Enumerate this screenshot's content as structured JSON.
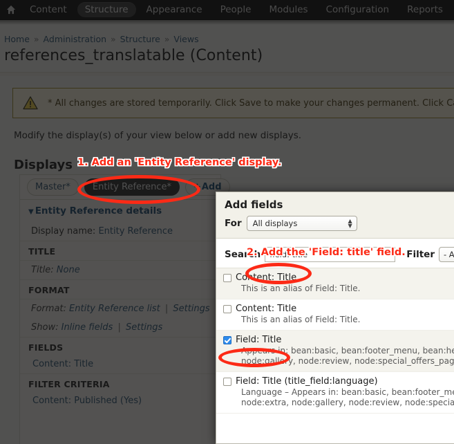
{
  "toolbar": {
    "home_icon": "home-icon",
    "items": [
      {
        "label": "Content",
        "active": false
      },
      {
        "label": "Structure",
        "active": true
      },
      {
        "label": "Appearance",
        "active": false
      },
      {
        "label": "People",
        "active": false
      },
      {
        "label": "Modules",
        "active": false
      },
      {
        "label": "Configuration",
        "active": false
      },
      {
        "label": "Reports",
        "active": false
      }
    ]
  },
  "breadcrumb": {
    "items": [
      "Home",
      "Administration",
      "Structure",
      "Views"
    ],
    "separator": "»"
  },
  "page": {
    "title": "references_translatable (Content)",
    "warning": "* All changes are stored temporarily. Click Save to make your changes permanent. Click Can",
    "modify_text": "Modify the display(s) of your view below or add new displays.",
    "displays_heading": "Displays"
  },
  "displays": {
    "tabs": [
      {
        "label": "Master*",
        "active": false
      },
      {
        "label": "Entity Reference*",
        "active": true
      }
    ],
    "add_label": "Add",
    "add_plus": "+",
    "details_heading": "Entity Reference details",
    "caret": "▼",
    "display_name_label": "Display name:",
    "display_name_value": "Entity Reference",
    "sections": [
      {
        "heading": "TITLE",
        "rows": [
          {
            "label": "Title:",
            "links": [
              "None"
            ]
          }
        ]
      },
      {
        "heading": "FORMAT",
        "rows": [
          {
            "label": "Format:",
            "links": [
              "Entity Reference list",
              "Settings"
            ]
          },
          {
            "label": "Show:",
            "links": [
              "Inline fields",
              "Settings"
            ]
          }
        ]
      },
      {
        "heading": "FIELDS",
        "items": [
          "Content: Title"
        ]
      },
      {
        "heading": "FILTER CRITERIA",
        "items": [
          "Content: Published (Yes)"
        ]
      }
    ],
    "separator": "|"
  },
  "modal": {
    "title": "Add fields",
    "for_label": "For",
    "for_value": "All displays",
    "search_label": "Search",
    "search_value": "field: title",
    "search_placeholder": "",
    "filter_label": "Filter",
    "filter_value": "- A",
    "options": [
      {
        "title": "Content: Title",
        "desc": "This is an alias of Field: Title.",
        "checked": false,
        "striped": true
      },
      {
        "title": "Content: Title",
        "desc": "This is an alias of Field: Title.",
        "checked": false,
        "striped": false
      },
      {
        "title": "Field: Title",
        "desc": "Appears in: bean:basic, bean:footer_menu, bean:hero\nnode:gallery, node:review, node:special_offers_page,",
        "checked": true,
        "striped": true
      },
      {
        "title": "Field: Title (title_field:language)",
        "desc": "Language – Appears in: bean:basic, bean:footer_menu\nnode:extra, node:gallery, node:review, node:special_o",
        "checked": false,
        "striped": false
      }
    ]
  },
  "annotations": {
    "step1": "1. Add an 'Entity Reference' display.",
    "step2": "2. Add the 'Field: title' field.",
    "accent_color": "#fc2a16"
  }
}
